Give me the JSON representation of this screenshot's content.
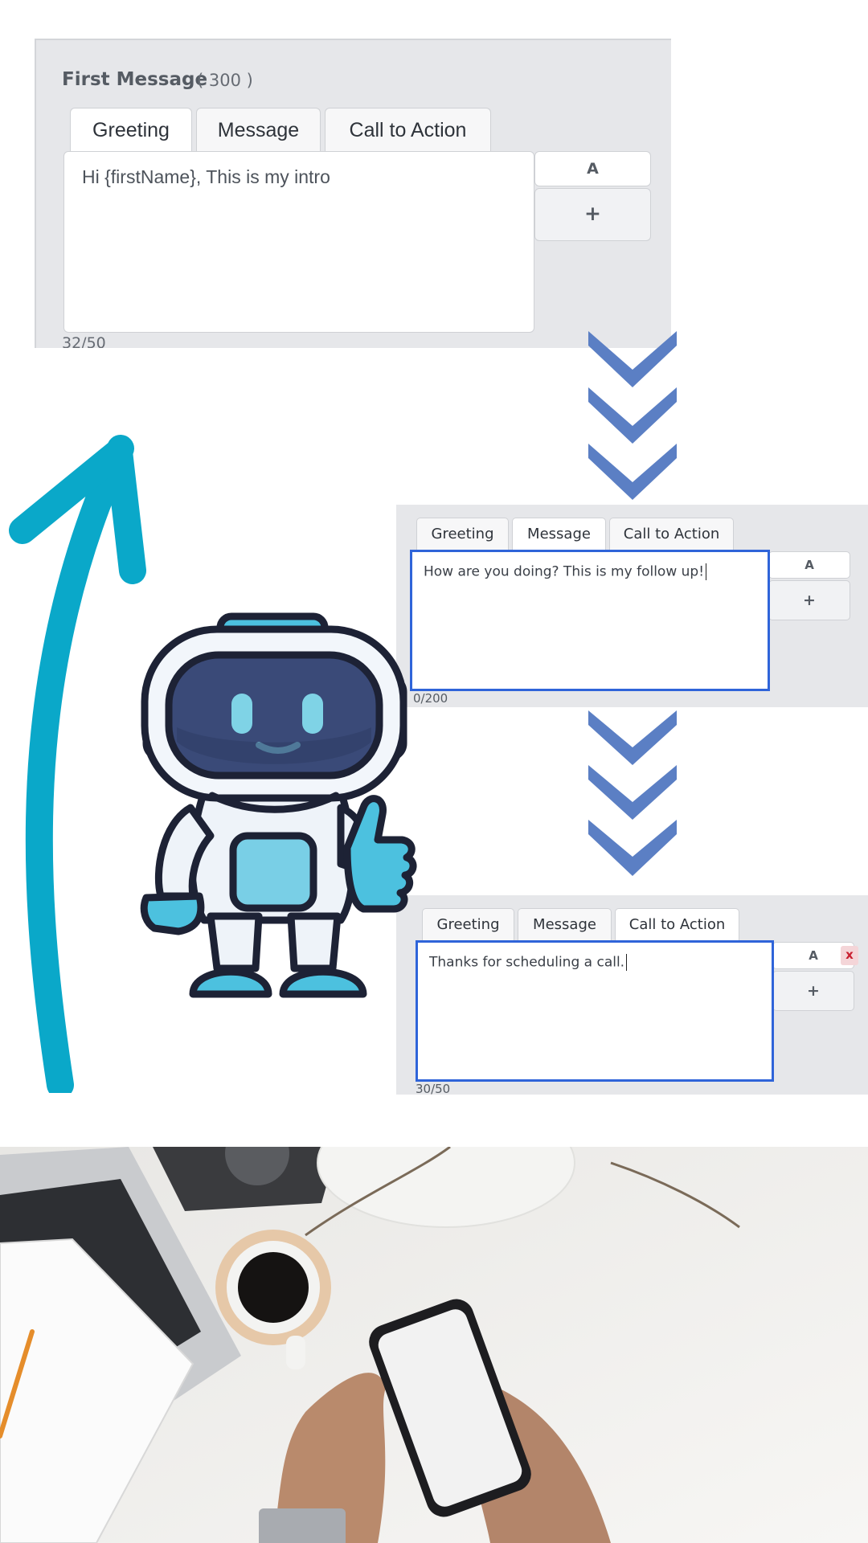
{
  "first_message": {
    "title": "First Message",
    "count": "( 300 )",
    "tabs": [
      "Greeting",
      "Message",
      "Call to Action"
    ],
    "text": "Hi {firstName}, This is my intro",
    "a_button": "A",
    "plus_button": "+",
    "counter": "32/50"
  },
  "second_message": {
    "tabs": [
      "Greeting",
      "Message",
      "Call to Action"
    ],
    "text": "How are you doing? This is my follow up!",
    "a_button": "A",
    "plus_button": "+",
    "counter": "0/200"
  },
  "third_message": {
    "tabs": [
      "Greeting",
      "Message",
      "Call to Action"
    ],
    "text": "Thanks for scheduling a call.",
    "a_button": "A",
    "close_button": "x",
    "plus_button": "+",
    "counter": "30/50"
  },
  "colors": {
    "panel": "#e6e7ea",
    "focus_border": "#2f64d9",
    "chevron": "#5b7fc4",
    "arrow": "#0aa8c9",
    "robot_outline": "#1d2235",
    "robot_accent": "#4cc1df"
  },
  "icons": [
    "chevron-down-icon",
    "curved-arrow-icon",
    "robot-illustration",
    "desk-phone-photo"
  ]
}
